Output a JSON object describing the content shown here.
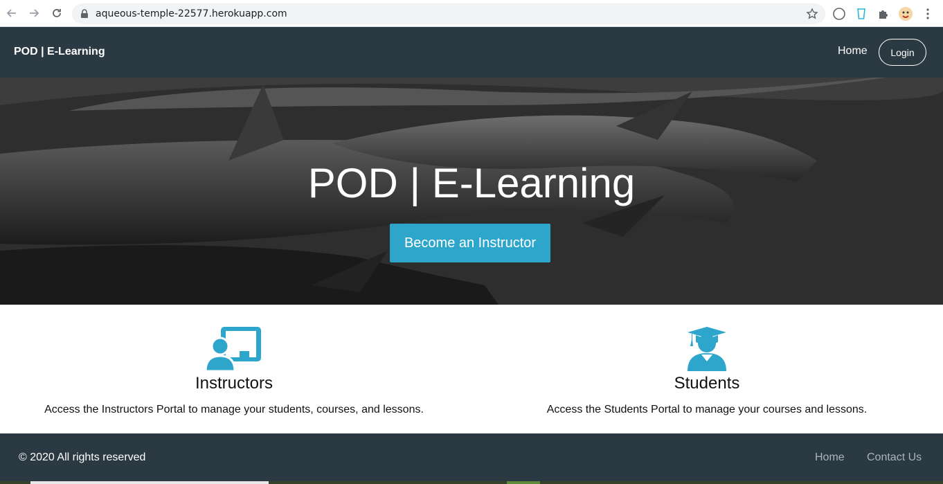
{
  "browser": {
    "url": "aqueous-temple-22577.herokuapp.com"
  },
  "navbar": {
    "brand": "POD | E-Learning",
    "home_label": "Home",
    "login_label": "Login"
  },
  "hero": {
    "title": "POD | E-Learning",
    "cta_label": "Become an Instructor"
  },
  "features": [
    {
      "title": "Instructors",
      "description": "Access the Instructors Portal to manage your students, courses, and lessons.",
      "icon": "instructor-board-icon"
    },
    {
      "title": "Students",
      "description": "Access the Students Portal to manage your courses and lessons.",
      "icon": "graduate-student-icon"
    }
  ],
  "footer": {
    "copyright": "© 2020 All rights reserved",
    "links": [
      "Home",
      "Contact Us"
    ]
  },
  "colors": {
    "navbar_bg": "#2b3a42",
    "accent": "#2ea6cc"
  }
}
